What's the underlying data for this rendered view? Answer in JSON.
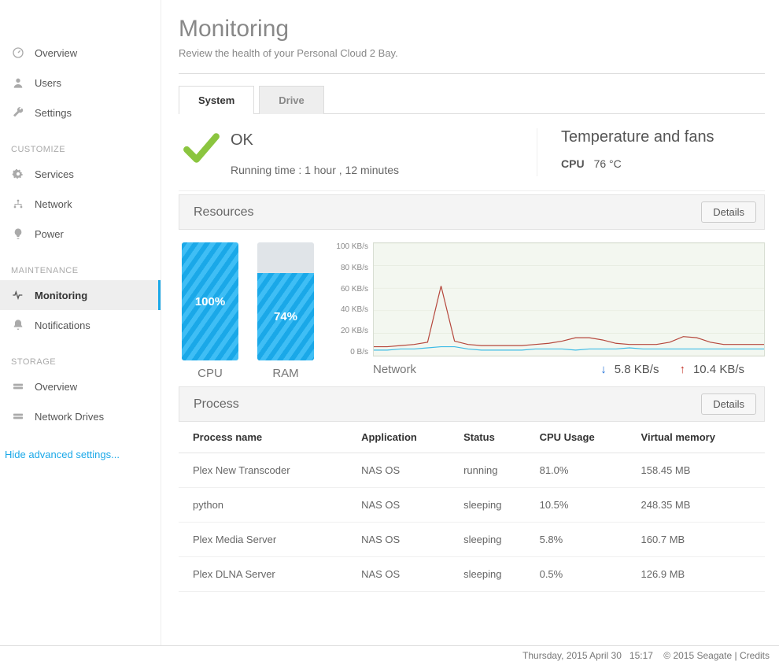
{
  "sidebar": {
    "nav": [
      {
        "icon": "dashboard",
        "label": "Overview"
      },
      {
        "icon": "user",
        "label": "Users"
      },
      {
        "icon": "wrench",
        "label": "Settings"
      }
    ],
    "customize_header": "CUSTOMIZE",
    "customize": [
      {
        "icon": "gear",
        "label": "Services"
      },
      {
        "icon": "network",
        "label": "Network"
      },
      {
        "icon": "power",
        "label": "Power"
      }
    ],
    "maintenance_header": "MAINTENANCE",
    "maintenance": [
      {
        "icon": "heartbeat",
        "label": "Monitoring",
        "active": true
      },
      {
        "icon": "bell",
        "label": "Notifications"
      }
    ],
    "storage_header": "STORAGE",
    "storage": [
      {
        "icon": "drive",
        "label": "Overview"
      },
      {
        "icon": "drive",
        "label": "Network Drives"
      }
    ],
    "hide_advanced": "Hide advanced settings..."
  },
  "page": {
    "title": "Monitoring",
    "subtitle": "Review the health of your Personal Cloud 2 Bay."
  },
  "tabs": [
    {
      "label": "System",
      "active": true
    },
    {
      "label": "Drive",
      "active": false
    }
  ],
  "status": {
    "label": "OK",
    "running_prefix": "Running time : ",
    "running_value": "1 hour ,  12 minutes"
  },
  "temperature": {
    "title": "Temperature and fans",
    "cpu_label": "CPU",
    "cpu_value": "76 °C"
  },
  "resources": {
    "header": "Resources",
    "details_btn": "Details",
    "cpu_label": "CPU",
    "cpu_pct": "100%",
    "cpu_pct_num": 100,
    "ram_label": "RAM",
    "ram_pct": "74%",
    "ram_pct_num": 74,
    "network_label": "Network",
    "down_value": "5.8 KB/s",
    "up_value": "10.4 KB/s",
    "yticks": [
      "100 KB/s",
      "80 KB/s",
      "60 KB/s",
      "40 KB/s",
      "20 KB/s",
      "0 B/s"
    ]
  },
  "chart_data": {
    "type": "line",
    "title": "Network",
    "ylabel": "KB/s",
    "ylim": [
      0,
      100
    ],
    "x": [
      0,
      1,
      2,
      3,
      4,
      5,
      6,
      7,
      8,
      9,
      10,
      11,
      12,
      13,
      14,
      15,
      16,
      17,
      18,
      19,
      20,
      21,
      22,
      23,
      24,
      25,
      26,
      27,
      28,
      29
    ],
    "series": [
      {
        "name": "Download",
        "color": "#3dbbe6",
        "values": [
          5,
          5,
          6,
          6,
          7,
          8,
          8,
          6,
          5,
          5,
          5,
          5,
          6,
          6,
          6,
          5,
          6,
          6,
          6,
          7,
          6,
          6,
          6,
          6,
          6,
          6,
          6,
          6,
          6,
          6
        ]
      },
      {
        "name": "Upload",
        "color": "#b5473c",
        "values": [
          8,
          8,
          9,
          10,
          12,
          62,
          13,
          10,
          9,
          9,
          9,
          9,
          10,
          11,
          13,
          16,
          16,
          14,
          11,
          10,
          10,
          10,
          12,
          17,
          16,
          12,
          10,
          10,
          10,
          10
        ]
      }
    ]
  },
  "process": {
    "header": "Process",
    "details_btn": "Details",
    "columns": [
      "Process name",
      "Application",
      "Status",
      "CPU Usage",
      "Virtual memory"
    ],
    "rows": [
      {
        "name": "Plex New Transcoder",
        "app": "NAS OS",
        "status": "running",
        "cpu": "81.0%",
        "vmem": "158.45 MB"
      },
      {
        "name": "python",
        "app": "NAS OS",
        "status": "sleeping",
        "cpu": "10.5%",
        "vmem": "248.35 MB"
      },
      {
        "name": "Plex Media Server",
        "app": "NAS OS",
        "status": "sleeping",
        "cpu": "5.8%",
        "vmem": "160.7 MB"
      },
      {
        "name": "Plex DLNA Server",
        "app": "NAS OS",
        "status": "sleeping",
        "cpu": "0.5%",
        "vmem": "126.9 MB"
      }
    ]
  },
  "footer": {
    "date": "Thursday, 2015 April 30",
    "time": "15:17",
    "copyright": "© 2015 Seagate",
    "credits": "Credits"
  }
}
